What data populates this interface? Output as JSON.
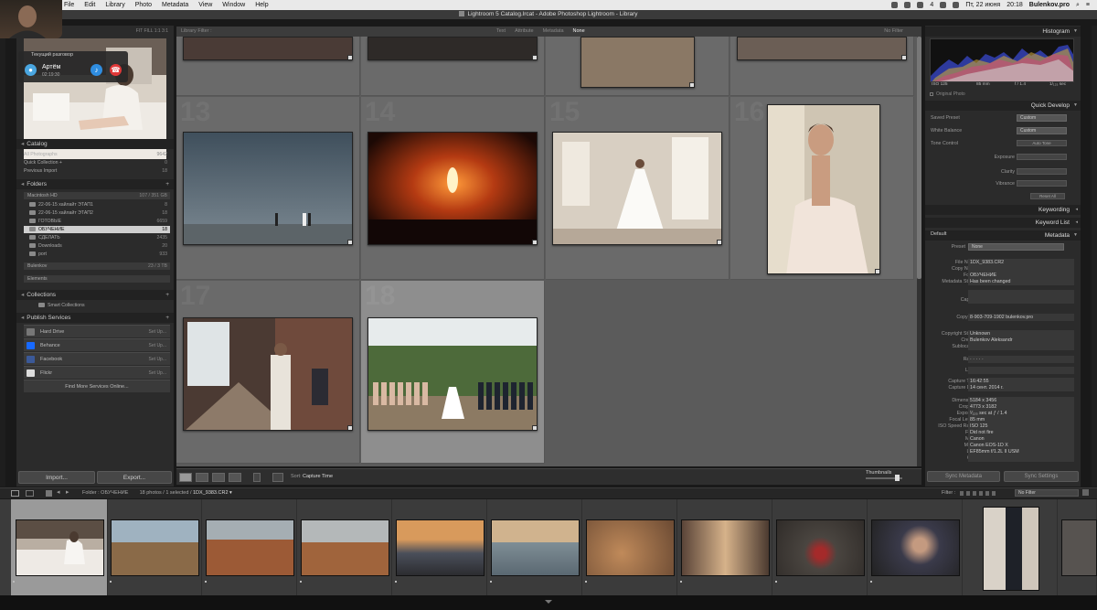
{
  "menubar": {
    "items": [
      "File",
      "Edit",
      "Library",
      "Photo",
      "Metadata",
      "View",
      "Window",
      "Help"
    ],
    "lang": "Пт, 22 июня",
    "time": "20:18",
    "site": "Bulenkov.pro",
    "counter": "4"
  },
  "titlebar": {
    "title": "Lightroom 5 Catalog.lrcat - Adobe Photoshop Lightroom - Library"
  },
  "call": {
    "title": "Текущий разговор",
    "name": "Артём",
    "time": "02:19:30"
  },
  "navigator": {
    "zoom": "FIT   FILL   1:1   3:1"
  },
  "catalog": {
    "header": "Catalog",
    "items": [
      {
        "label": "All Photographs",
        "count": "9642"
      },
      {
        "label": "Quick Collection +",
        "count": "0"
      },
      {
        "label": "Previous Import",
        "count": "18"
      }
    ]
  },
  "folders": {
    "header": "Folders",
    "volume": {
      "label": "Macintosh HD",
      "count": "107 / 351 GB"
    },
    "items": [
      {
        "label": "22-06-15 хайлайт ЭТАП1",
        "count": "8"
      },
      {
        "label": "22-06-15 хайлайт ЭТАП2",
        "count": "18"
      },
      {
        "label": "ГОТОВЫЕ",
        "count": "6659"
      },
      {
        "label": "ОБУЧЕНИЕ",
        "count": "18"
      },
      {
        "label": "СДЕЛАТЬ",
        "count": "2435"
      },
      {
        "label": "Downloads",
        "count": "20"
      },
      {
        "label": "port",
        "count": "933"
      }
    ],
    "volume2": {
      "label": "Bulenkov",
      "count": "23 / 3 TB"
    },
    "elements": "Elements"
  },
  "collections": {
    "header": "Collections",
    "smart": "Smart Collections"
  },
  "publish": {
    "header": "Publish Services",
    "items": [
      {
        "label": "Hard Drive",
        "setup": "Set Up...",
        "color": "#777777"
      },
      {
        "label": "Behance",
        "setup": "Set Up...",
        "color": "#1769ff"
      },
      {
        "label": "Facebook",
        "setup": "Set Up...",
        "color": "#3b5998"
      },
      {
        "label": "Flickr",
        "setup": "Set Up...",
        "color": "#dddddd"
      }
    ],
    "find_more": "Find More Services Online..."
  },
  "buttons": {
    "import": "Import...",
    "export": "Export...",
    "sync_meta": "Sync Metadata",
    "sync_set": "Sync Settings"
  },
  "filterbar": {
    "label": "Library Filter :",
    "tabs": [
      "Text",
      "Attribute",
      "Metadata",
      "None"
    ],
    "active_tab": "None",
    "nofilter": "No Filter"
  },
  "grid": {
    "cell_numbers": [
      "13",
      "14",
      "15",
      "16",
      "17",
      "18"
    ],
    "selected_cell": "18"
  },
  "toolbar": {
    "sort_label": "Sort:",
    "sort_value": "Capture Time",
    "thumbnails": "Thumbnails"
  },
  "histogram": {
    "header": "Histogram",
    "iso": "ISO 125",
    "focal": "85 mm",
    "aperture": "f / 1.4",
    "shutter": "1/₁₂₅ sec",
    "original": "Original Photo"
  },
  "quick_develop": {
    "header": "Quick Develop",
    "saved_preset_label": "Saved Preset",
    "saved_preset": "Custom",
    "wb_label": "White Balance",
    "wb": "Custom",
    "tone_label": "Tone Control",
    "auto_tone": "Auto Tone",
    "exposure": "Exposure",
    "clarity": "Clarity",
    "vibrance": "Vibrance",
    "reset": "Reset All"
  },
  "keywording": {
    "header": "Keywording"
  },
  "keyword_list": {
    "header": "Keyword List"
  },
  "metadata": {
    "header": "Metadata",
    "mode": "Default",
    "preset_label": "Preset",
    "preset": "None",
    "fields": [
      {
        "label": "File Name",
        "value": "1DX_9383.CR2"
      },
      {
        "label": "Copy Name",
        "value": ""
      },
      {
        "label": "Folder",
        "value": "ОБУЧЕНИЕ"
      },
      {
        "label": "Metadata Status",
        "value": "Has been changed"
      },
      {
        "label": "Title",
        "value": ""
      },
      {
        "label": "Caption",
        "value": ""
      },
      {
        "label": "Copyright",
        "value": "8-903-709-1902 bulenkov.pro"
      },
      {
        "label": "Copyright Status",
        "value": "Unknown"
      },
      {
        "label": "Creator",
        "value": "Bulenkov Aleksandr"
      },
      {
        "label": "Sublocation",
        "value": ""
      },
      {
        "label": "Rating",
        "value": "· · · · ·"
      },
      {
        "label": "Label",
        "value": ""
      },
      {
        "label": "Capture Time",
        "value": "16:42:55"
      },
      {
        "label": "Capture Date",
        "value": "14 сент. 2014 г."
      },
      {
        "label": "Dimensions",
        "value": "5184 x 3456"
      },
      {
        "label": "Cropped",
        "value": "4773 x 3182"
      },
      {
        "label": "Exposure",
        "value": "¹⁄₁₂₅ sec at ƒ / 1.4"
      },
      {
        "label": "Focal Length",
        "value": "85 mm"
      },
      {
        "label": "ISO Speed Rating",
        "value": "ISO 125"
      },
      {
        "label": "Flash",
        "value": "Did not fire"
      },
      {
        "label": "Make",
        "value": "Canon"
      },
      {
        "label": "Model",
        "value": "Canon EOS-1D X"
      },
      {
        "label": "Lens",
        "value": "EF85mm f/1.2L II USM"
      },
      {
        "label": "GPS",
        "value": ""
      }
    ]
  },
  "filmstrip": {
    "folder_label": "Folder : ОБУЧЕНИЕ",
    "count": "18 photos / 1 selected /",
    "file": "1DX_9383.CR2 ▾",
    "filter_label": "Filter :",
    "filter_value": "No Filter"
  }
}
